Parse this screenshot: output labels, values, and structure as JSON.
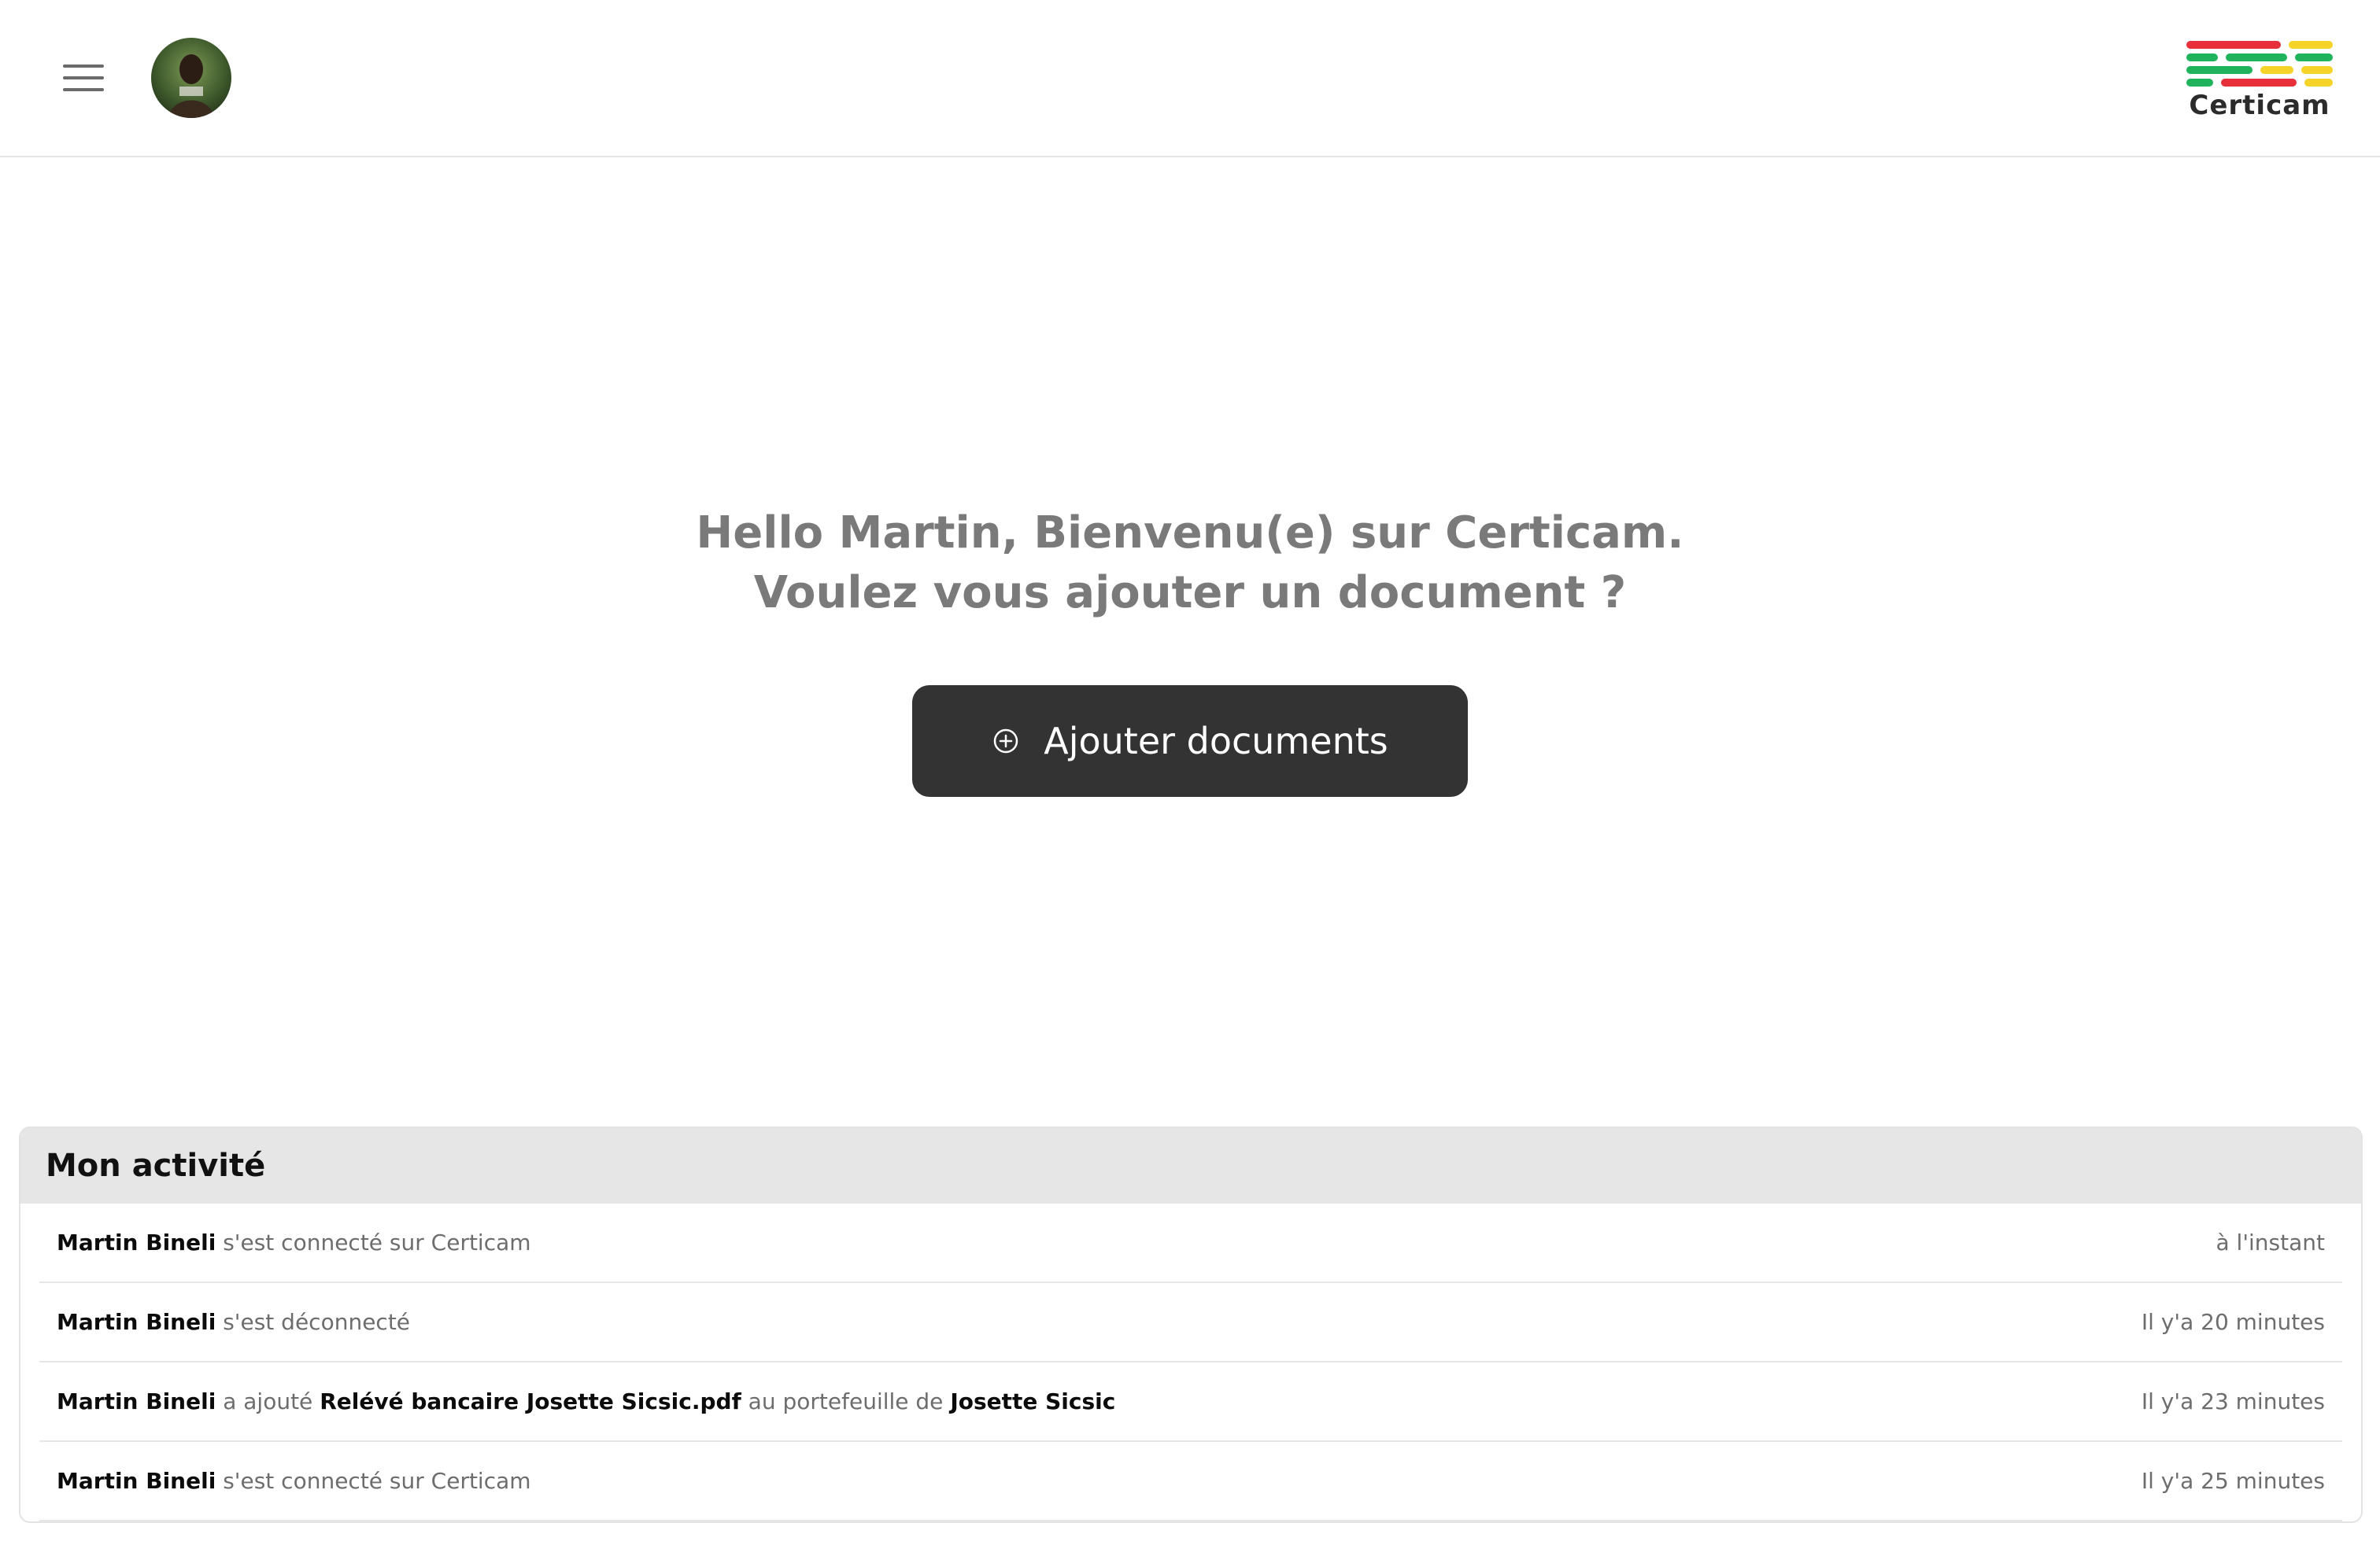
{
  "header": {
    "menu_icon": "hamburger-menu-icon",
    "avatar_icon": "user-avatar",
    "logo_text": "Certicam",
    "logo_colors": [
      "#e8303a",
      "#1fb35b",
      "#f5d328"
    ]
  },
  "hero": {
    "line1": "Hello Martin, Bienvenu(e) sur Certicam.",
    "line2": "Voulez vous ajouter un document ?",
    "button_label": "Ajouter documents",
    "button_icon": "plus-circle-icon"
  },
  "activity": {
    "title": "Mon activité",
    "rows": [
      {
        "user": "Martin Bineli",
        "action": " s'est connecté sur Certicam",
        "doc": "",
        "mid": "",
        "target": "",
        "time": "à l'instant"
      },
      {
        "user": "Martin Bineli",
        "action": " s'est déconnecté",
        "doc": "",
        "mid": "",
        "target": "",
        "time": "Il y'a 20 minutes"
      },
      {
        "user": "Martin Bineli",
        "action": " a ajouté ",
        "doc": "Relévé bancaire Josette Sicsic.pdf",
        "mid": " au portefeuille de ",
        "target": "Josette Sicsic",
        "time": "Il y'a 23 minutes"
      },
      {
        "user": "Martin Bineli",
        "action": " s'est connecté sur Certicam",
        "doc": "",
        "mid": "",
        "target": "",
        "time": "Il y'a 25 minutes"
      }
    ]
  }
}
